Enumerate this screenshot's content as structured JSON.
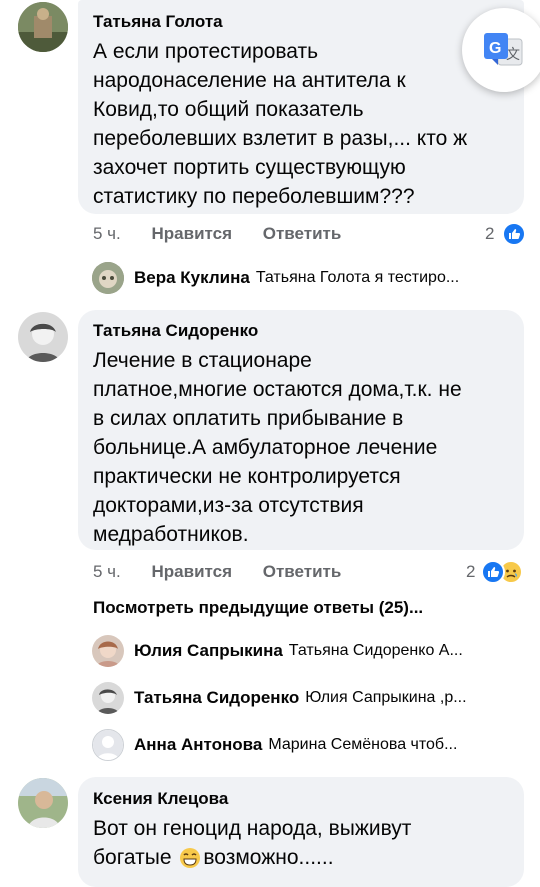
{
  "comments": [
    {
      "author": "Татьяна Голота",
      "lines": [
        "А если протестировать",
        "народонаселение на антитела к",
        "Ковид,то общий показатель",
        "переболевших взлетит в разы,... кто ж",
        "захочет портить существующую",
        "статистику по переболевшим???"
      ],
      "time": "5 ч.",
      "like_label": "Нравится",
      "reply_label": "Ответить",
      "reaction_count": "2"
    },
    {
      "author": "Татьяна Сидоренко",
      "lines": [
        "Лечение в стационаре",
        "платное,многие остаются дома,т.к. не",
        "в силах оплатить прибывание в",
        "больнице.А амбулаторное лечение",
        "практически не контролируется",
        "докторами,из-за отсутствия",
        "медработников."
      ],
      "time": "5 ч.",
      "like_label": "Нравится",
      "reply_label": "Ответить",
      "reaction_count": "2"
    },
    {
      "author": "Ксения Клецова",
      "line1": "Вот он геноцид народа, выживут",
      "line2_before": "богатые ",
      "line2_after": "возможно......"
    }
  ],
  "replies": [
    {
      "name": "Вера Куклина",
      "text": "Татьяна Голота я тестиро..."
    },
    {
      "name": "Юлия Сапрыкина",
      "text": "Татьяна Сидоренко А..."
    },
    {
      "name": "Татьяна Сидоренко",
      "text": "Юлия Сапрыкина ,р..."
    },
    {
      "name": "Анна Антонова",
      "text": "Марина Семёнова чтоб..."
    }
  ],
  "view_previous": "Посмотреть предыдущие ответы (25)...",
  "icons": {
    "translate": "google-translate-icon",
    "like": "like-reaction-icon",
    "sad": "sad-reaction-icon",
    "grin": "grinning-emoji-icon"
  },
  "colors": {
    "bubble": "#f0f2f5",
    "like_blue": "#1877f2",
    "meta_gray": "#65676b"
  }
}
